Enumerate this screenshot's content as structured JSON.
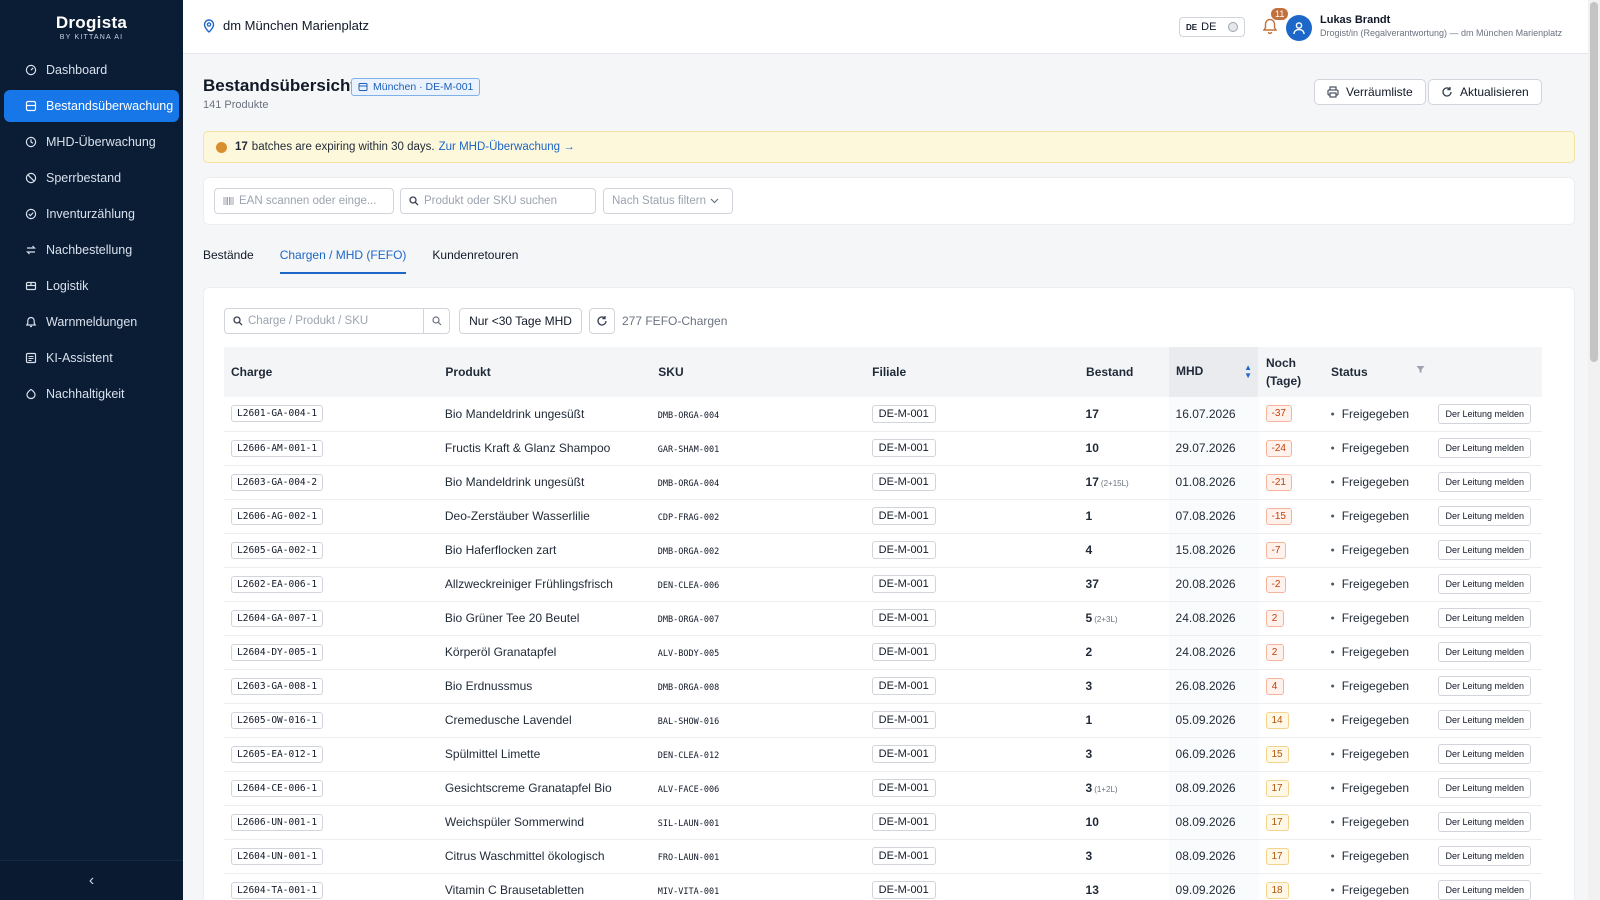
{
  "brand": {
    "name": "Drogista",
    "sub": "BY KITTANA AI"
  },
  "sidebar": {
    "items": [
      {
        "label": "Dashboard",
        "icon": "dashboard-icon",
        "active": false
      },
      {
        "label": "Bestandsüberwachung",
        "icon": "inventory-icon",
        "active": true
      },
      {
        "label": "MHD-Überwachung",
        "icon": "clock-icon",
        "active": false
      },
      {
        "label": "Sperrbestand",
        "icon": "block-icon",
        "active": false
      },
      {
        "label": "Inventurzählung",
        "icon": "check-circle-icon",
        "active": false
      },
      {
        "label": "Nachbestellung",
        "icon": "reorder-icon",
        "active": false
      },
      {
        "label": "Logistik",
        "icon": "truck-icon",
        "active": false
      },
      {
        "label": "Warnmeldungen",
        "icon": "bell-icon",
        "active": false
      },
      {
        "label": "KI-Assistent",
        "icon": "chat-icon",
        "active": false
      },
      {
        "label": "Nachhaltigkeit",
        "icon": "leaf-icon",
        "active": false
      }
    ],
    "collapse_label": "‹"
  },
  "topbar": {
    "location": "dm München Marienplatz",
    "lang_flag": "DE",
    "lang": "DE",
    "notifications": "11",
    "user_name": "Lukas Brandt",
    "user_role": "Drogist/in (Regalverantwortung) — dm München Marienplatz"
  },
  "header": {
    "title": "Bestandsübersicht",
    "store_tag": "München · DE-M-001",
    "product_count": "141 Produkte",
    "btn_list": "Verräumliste",
    "btn_refresh": "Aktualisieren"
  },
  "alert": {
    "count": "17",
    "text": "batches are expiring within 30 days.",
    "link": "Zur MHD-Überwachung →"
  },
  "filters": {
    "ean_placeholder": "EAN scannen oder einge...",
    "search_placeholder": "Produkt oder SKU suchen",
    "status_placeholder": "Nach Status filtern"
  },
  "tabs": [
    "Bestände",
    "Chargen / MHD (FEFO)",
    "Kundenretouren"
  ],
  "table_tools": {
    "search_placeholder": "Charge / Produkt / SKU",
    "toggle_label": "Nur <30 Tage MHD",
    "count_label": "277 FEFO-Chargen"
  },
  "columns": [
    "Charge",
    "Produkt",
    "SKU",
    "Filiale",
    "Bestand",
    "MHD",
    "Noch (Tage)",
    "Status"
  ],
  "rows": [
    {
      "charge": "L2601-GA-004-1",
      "produkt": "Bio Mandeldrink ungesüßt",
      "sku": "DMB-ORGA-004",
      "filiale": "DE-M-001",
      "bestand": "17",
      "bestand_note": "",
      "mhd": "16.07.2026",
      "tage": "-37",
      "tone": "red",
      "status": "Freigegeben",
      "action": "Der Leitung melden"
    },
    {
      "charge": "L2606-AM-001-1",
      "produkt": "Fructis Kraft & Glanz Shampoo",
      "sku": "GAR-SHAM-001",
      "filiale": "DE-M-001",
      "bestand": "10",
      "bestand_note": "",
      "mhd": "29.07.2026",
      "tage": "-24",
      "tone": "red",
      "status": "Freigegeben",
      "action": "Der Leitung melden"
    },
    {
      "charge": "L2603-GA-004-2",
      "produkt": "Bio Mandeldrink ungesüßt",
      "sku": "DMB-ORGA-004",
      "filiale": "DE-M-001",
      "bestand": "17",
      "bestand_note": "(2+15L)",
      "mhd": "01.08.2026",
      "tage": "-21",
      "tone": "red",
      "status": "Freigegeben",
      "action": "Der Leitung melden"
    },
    {
      "charge": "L2606-AG-002-1",
      "produkt": "Deo-Zerstäuber Wasserlilie",
      "sku": "CDP-FRAG-002",
      "filiale": "DE-M-001",
      "bestand": "1",
      "bestand_note": "",
      "mhd": "07.08.2026",
      "tage": "-15",
      "tone": "red",
      "status": "Freigegeben",
      "action": "Der Leitung melden"
    },
    {
      "charge": "L2605-GA-002-1",
      "produkt": "Bio Haferflocken zart",
      "sku": "DMB-ORGA-002",
      "filiale": "DE-M-001",
      "bestand": "4",
      "bestand_note": "",
      "mhd": "15.08.2026",
      "tage": "-7",
      "tone": "red",
      "status": "Freigegeben",
      "action": "Der Leitung melden"
    },
    {
      "charge": "L2602-EA-006-1",
      "produkt": "Allzweckreiniger Frühlingsfrisch",
      "sku": "DEN-CLEA-006",
      "filiale": "DE-M-001",
      "bestand": "37",
      "bestand_note": "",
      "mhd": "20.08.2026",
      "tage": "-2",
      "tone": "red",
      "status": "Freigegeben",
      "action": "Der Leitung melden"
    },
    {
      "charge": "L2604-GA-007-1",
      "produkt": "Bio Grüner Tee 20 Beutel",
      "sku": "DMB-ORGA-007",
      "filiale": "DE-M-001",
      "bestand": "5",
      "bestand_note": "(2+3L)",
      "mhd": "24.08.2026",
      "tage": "2",
      "tone": "red",
      "status": "Freigegeben",
      "action": "Der Leitung melden"
    },
    {
      "charge": "L2604-DY-005-1",
      "produkt": "Körperöl Granatapfel",
      "sku": "ALV-BODY-005",
      "filiale": "DE-M-001",
      "bestand": "2",
      "bestand_note": "",
      "mhd": "24.08.2026",
      "tage": "2",
      "tone": "red",
      "status": "Freigegeben",
      "action": "Der Leitung melden"
    },
    {
      "charge": "L2603-GA-008-1",
      "produkt": "Bio Erdnussmus",
      "sku": "DMB-ORGA-008",
      "filiale": "DE-M-001",
      "bestand": "3",
      "bestand_note": "",
      "mhd": "26.08.2026",
      "tage": "4",
      "tone": "red",
      "status": "Freigegeben",
      "action": "Der Leitung melden"
    },
    {
      "charge": "L2605-OW-016-1",
      "produkt": "Cremedusche Lavendel",
      "sku": "BAL-SHOW-016",
      "filiale": "DE-M-001",
      "bestand": "1",
      "bestand_note": "",
      "mhd": "05.09.2026",
      "tage": "14",
      "tone": "amber",
      "status": "Freigegeben",
      "action": "Der Leitung melden"
    },
    {
      "charge": "L2605-EA-012-1",
      "produkt": "Spülmittel Limette",
      "sku": "DEN-CLEA-012",
      "filiale": "DE-M-001",
      "bestand": "3",
      "bestand_note": "",
      "mhd": "06.09.2026",
      "tage": "15",
      "tone": "amber",
      "status": "Freigegeben",
      "action": "Der Leitung melden"
    },
    {
      "charge": "L2604-CE-006-1",
      "produkt": "Gesichtscreme Granatapfel Bio",
      "sku": "ALV-FACE-006",
      "filiale": "DE-M-001",
      "bestand": "3",
      "bestand_note": "(1+2L)",
      "mhd": "08.09.2026",
      "tage": "17",
      "tone": "amber",
      "status": "Freigegeben",
      "action": "Der Leitung melden"
    },
    {
      "charge": "L2606-UN-001-1",
      "produkt": "Weichspüler Sommerwind",
      "sku": "SIL-LAUN-001",
      "filiale": "DE-M-001",
      "bestand": "10",
      "bestand_note": "",
      "mhd": "08.09.2026",
      "tage": "17",
      "tone": "amber",
      "status": "Freigegeben",
      "action": "Der Leitung melden"
    },
    {
      "charge": "L2604-UN-001-1",
      "produkt": "Citrus Waschmittel ökologisch",
      "sku": "FRO-LAUN-001",
      "filiale": "DE-M-001",
      "bestand": "3",
      "bestand_note": "",
      "mhd": "08.09.2026",
      "tage": "17",
      "tone": "amber",
      "status": "Freigegeben",
      "action": "Der Leitung melden"
    },
    {
      "charge": "L2604-TA-001-1",
      "produkt": "Vitamin C Brausetabletten",
      "sku": "MIV-VITA-001",
      "filiale": "DE-M-001",
      "bestand": "13",
      "bestand_note": "",
      "mhd": "09.09.2026",
      "tage": "18",
      "tone": "amber",
      "status": "Freigegeben",
      "action": "Der Leitung melden"
    }
  ]
}
